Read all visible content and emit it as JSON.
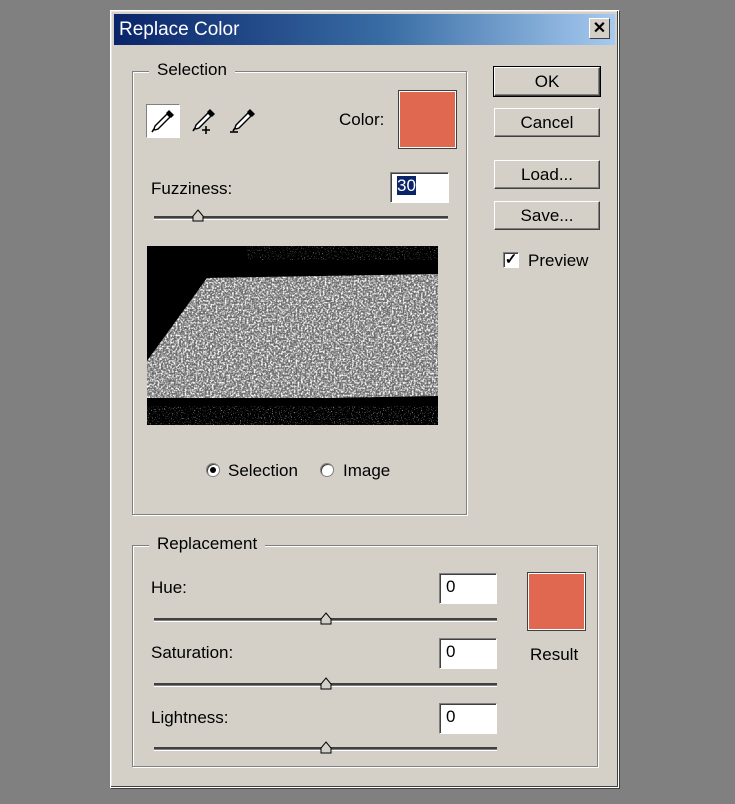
{
  "window": {
    "title": "Replace Color",
    "close_glyph": "✕"
  },
  "selection": {
    "group_label": "Selection",
    "tools": [
      "eyedropper-icon",
      "eyedropper-plus-icon",
      "eyedropper-minus-icon"
    ],
    "color_label": "Color:",
    "color_value": "#e06750",
    "fuzziness_label": "Fuzziness:",
    "fuzziness_value": "30",
    "fuzziness_fraction": 0.15,
    "view_options": [
      {
        "label": "Selection",
        "checked": true
      },
      {
        "label": "Image",
        "checked": false
      }
    ]
  },
  "buttons": {
    "ok": "OK",
    "cancel": "Cancel",
    "load": "Load...",
    "save": "Save..."
  },
  "preview": {
    "label": "Preview",
    "checked": true,
    "check_glyph": "✓"
  },
  "replacement": {
    "group_label": "Replacement",
    "hue_label": "Hue:",
    "hue_value": "0",
    "saturation_label": "Saturation:",
    "saturation_value": "0",
    "lightness_label": "Lightness:",
    "lightness_value": "0",
    "result_label": "Result",
    "result_color": "#e06750",
    "slider_fraction": 0.5
  }
}
